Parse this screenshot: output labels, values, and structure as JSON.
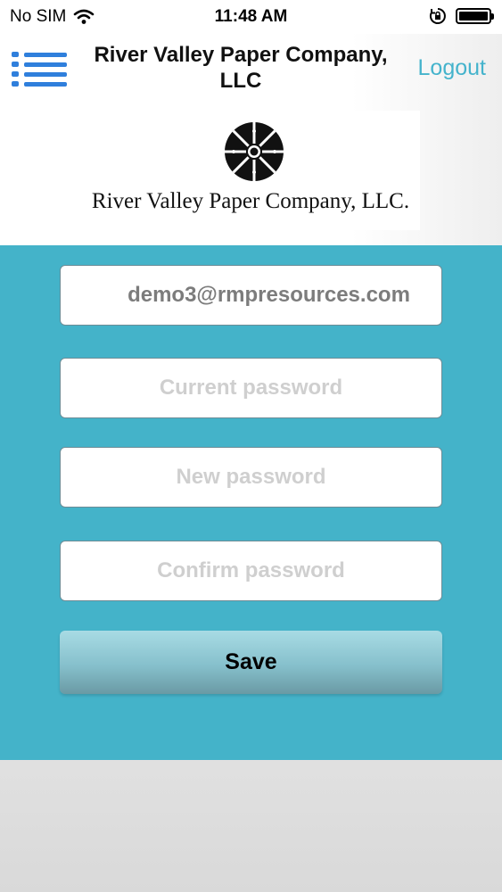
{
  "status_bar": {
    "carrier": "No SIM",
    "time": "11:48 AM",
    "icons": [
      "wifi-icon",
      "orientation-lock-icon",
      "battery-icon"
    ]
  },
  "header": {
    "title": "River Valley Paper Company, LLC",
    "logout_label": "Logout",
    "menu_icon": "hamburger-menu-icon",
    "accent_color": "#2f7fdc",
    "logout_color": "#44b3cc"
  },
  "logo": {
    "text": "River Valley Paper Company, LLC.",
    "icon": "flower-logo-icon"
  },
  "form": {
    "panel_color": "#44b3c9",
    "email_value": "demo3@rmpresources.com",
    "current_password_placeholder": "Current password",
    "new_password_placeholder": "New password",
    "confirm_password_placeholder": "Confirm password",
    "save_label": "Save"
  }
}
